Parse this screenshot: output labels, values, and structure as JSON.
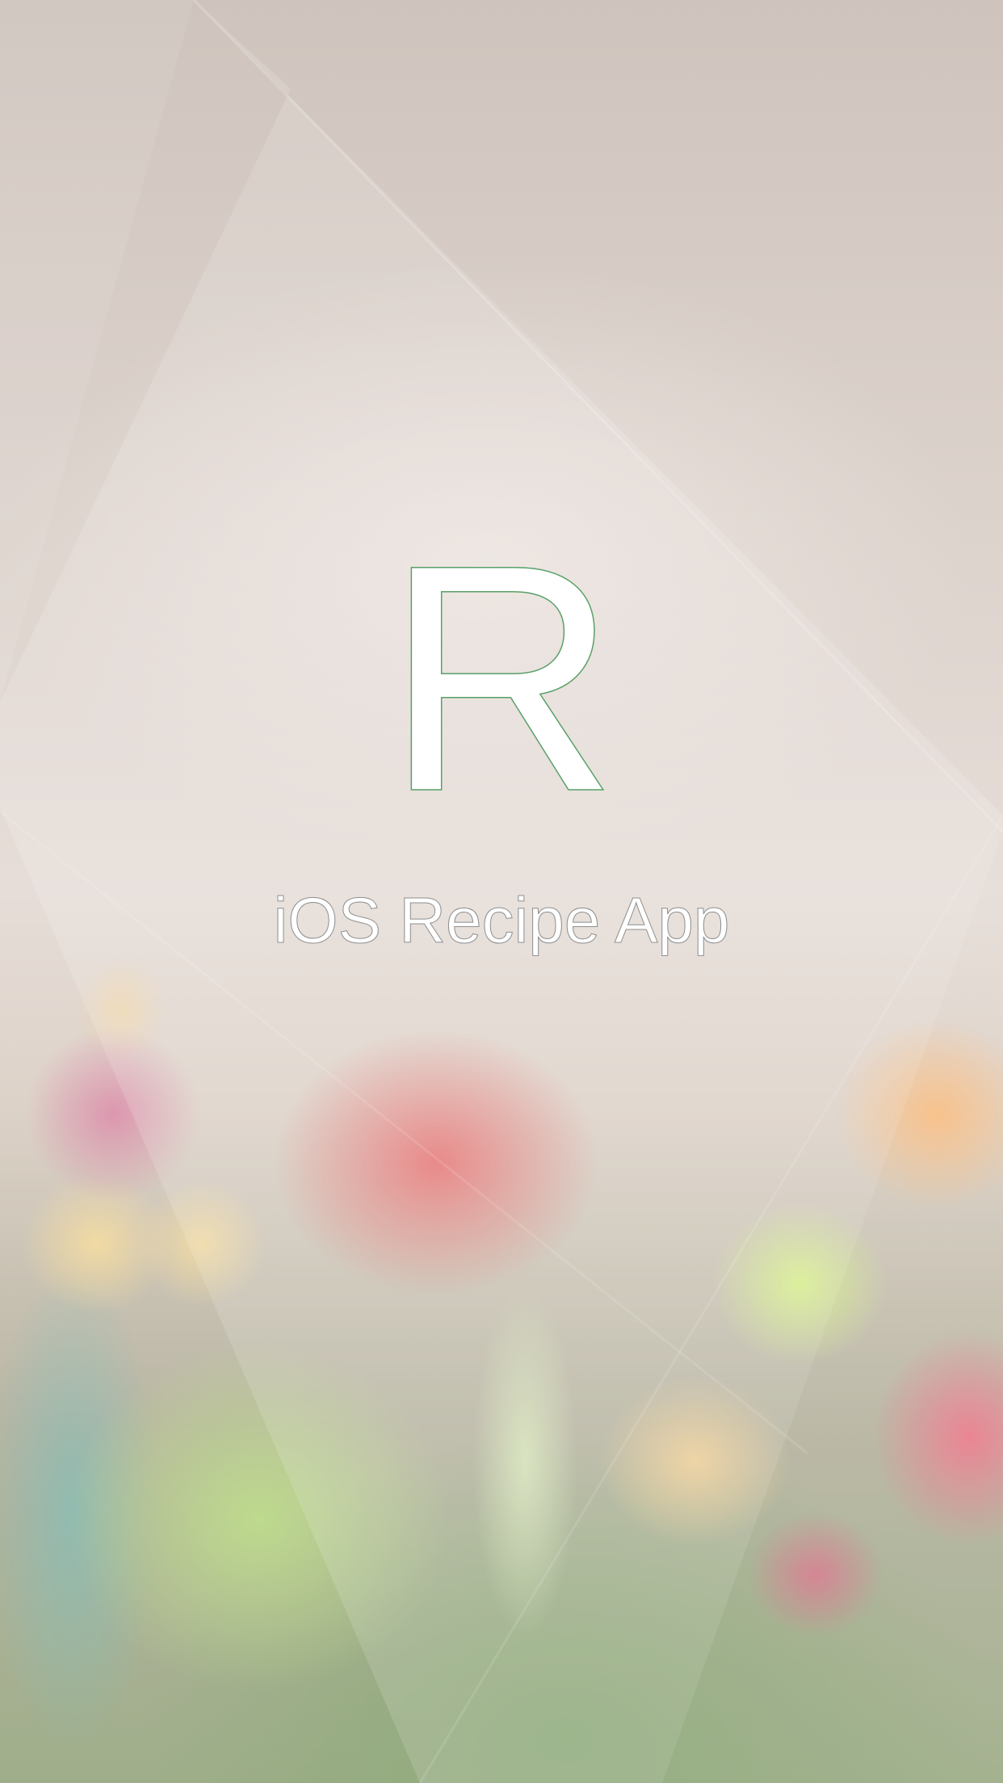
{
  "splash": {
    "logo_letter": "R",
    "app_title": "iOS Recipe App"
  },
  "colors": {
    "logo_fill": "#ffffff",
    "logo_outline": "#5aa068",
    "title_fill": "#ffffff",
    "title_outline": "#8f8f8f"
  },
  "icons": [
    "app-logo-icon"
  ]
}
